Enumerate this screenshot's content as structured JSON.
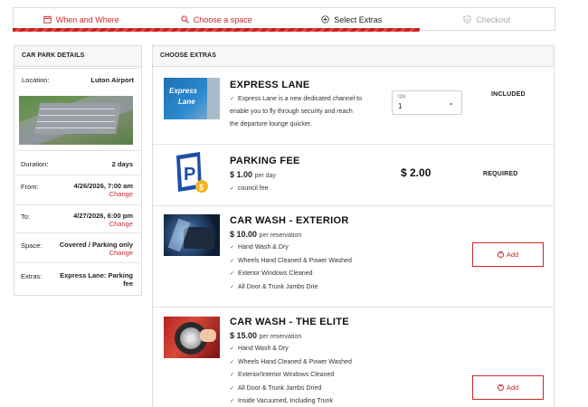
{
  "stepper": {
    "steps": [
      {
        "label": "When and Where",
        "icon": "calendar-icon",
        "state": "done"
      },
      {
        "label": "Choose a space",
        "icon": "search-icon",
        "state": "done"
      },
      {
        "label": "Select Extras",
        "icon": "plus-circle-icon",
        "state": "current"
      },
      {
        "label": "Checkout",
        "icon": "shield-check-icon",
        "state": "upcoming"
      }
    ],
    "colors": {
      "accent": "#d02828",
      "current": "#222222",
      "upcoming": "#a8a8a8"
    }
  },
  "car_park": {
    "heading": "CAR PARK DETAILS",
    "location_label": "Location:",
    "location_value": "Luton Airport",
    "map_image": "aerial-parking-lot-image",
    "duration_label": "Duration:",
    "duration_value": "2 days",
    "from_label": "From:",
    "from_value": "4/26/2026, 7:00 am",
    "from_change": "Change",
    "to_label": "To:",
    "to_value": "4/27/2026, 6:00 pm",
    "to_change": "Change",
    "space_label": "Space:",
    "space_value": "Covered / Parking only",
    "space_change": "Change",
    "extras_label": "Extras:",
    "extras_value_1": "Express Lane: Parking",
    "extras_value_2": "fee"
  },
  "extras": {
    "heading": "CHOOSE EXTRAS",
    "express": {
      "title": "EXPRESS LANE",
      "features": [
        "Express Lane is a new dedicated channel to",
        "enable you to fly through security and reach",
        "the departure lounge quicker."
      ],
      "qty_label": "Qty",
      "qty_value": "1",
      "status": "INCLUDED",
      "image": "express-lane-sign-image"
    },
    "parking": {
      "title": "PARKING FEE",
      "price": "$ 1.00",
      "unit": "per day",
      "features": [
        "council fee"
      ],
      "total": "$ 2.00",
      "status": "REQUIRED",
      "image": "parking-sign-icon"
    },
    "wash_ext": {
      "title": "CAR WASH - EXTERIOR",
      "price": "$ 10.00",
      "unit": "per reservation",
      "features": [
        "Hand Wash & Dry",
        "Wheels Hand Cleaned & Power Washed",
        "Exterior Windows Cleaned",
        "All Door & Trunk Jambs Drie"
      ],
      "button": "Add",
      "image": "car-wash-image"
    },
    "wash_elite": {
      "title": "CAR WASH - THE ELITE",
      "price": "$ 15.00",
      "unit": "per reservation",
      "features": [
        "Hand Wash & Dry",
        "Wheels Hand Cleaned & Power Washed",
        "Exterior/Interior Windows Cleaned",
        "All Door & Trunk Jambs Dried",
        "Inside Vacuumed, Including Trunk"
      ],
      "button": "Add",
      "image": "wheel-cleaning-image"
    }
  }
}
